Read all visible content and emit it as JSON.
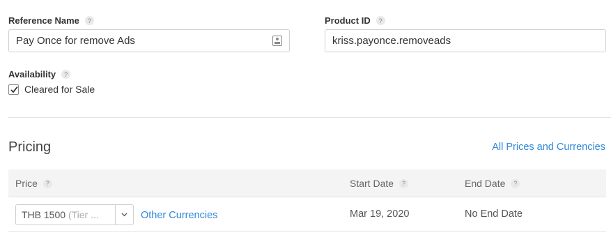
{
  "reference_name": {
    "label": "Reference Name",
    "help": "?",
    "value": "Pay Once for remove Ads",
    "icon": "contact-card-icon"
  },
  "product_id": {
    "label": "Product ID",
    "help": "?",
    "value": "kriss.payonce.removeads"
  },
  "availability": {
    "label": "Availability",
    "help": "?",
    "checkbox_label": "Cleared for Sale",
    "checked": true
  },
  "pricing": {
    "title": "Pricing",
    "all_prices_link": "All Prices and Currencies",
    "columns": {
      "price": "Price",
      "start_date": "Start Date",
      "end_date": "End Date",
      "help": "?"
    },
    "row": {
      "price_value": "THB 1500",
      "price_tier": "(Tier ...",
      "other_currencies": "Other Currencies",
      "start_date": "Mar 19, 2020",
      "end_date": "No End Date"
    }
  },
  "colors": {
    "link": "#2f88d8",
    "header_bg": "#f4f4f4"
  }
}
